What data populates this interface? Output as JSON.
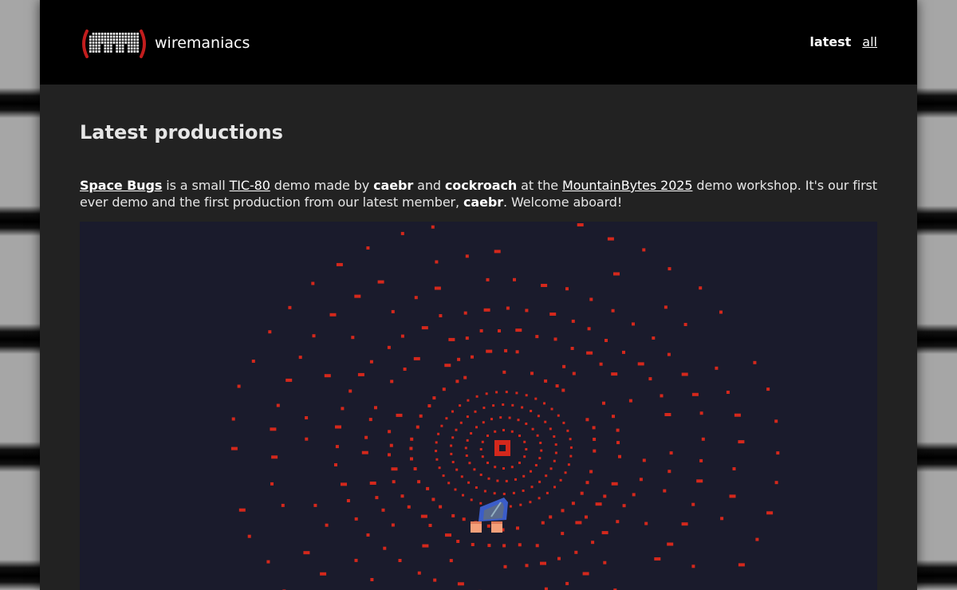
{
  "header": {
    "brand": "wiremaniacs",
    "logo_text": "(wm)",
    "nav": [
      {
        "label": "latest",
        "active": true
      },
      {
        "label": "all",
        "active": false
      }
    ]
  },
  "main": {
    "title": "Latest productions",
    "intro": {
      "prod_name": "Space Bugs",
      "t1": " is a small ",
      "platform": "TIC-80",
      "t2": " demo made by ",
      "author1": "caebr",
      "t3": " and ",
      "author2": "cockroach",
      "t4": " at the ",
      "event": "MountainBytes 2025",
      "t5": " demo workshop. It's our first ever demo and the first production from our latest member, ",
      "member": "caebr",
      "t6": ". Welcome aboard!"
    },
    "screenshot": {
      "background": "#1a1b2c",
      "dot_color": "#d4281c",
      "ship_colors": [
        "#3b5dc9",
        "#94b0c2",
        "#f4a07a"
      ]
    }
  },
  "colors": {
    "header_bg": "#000000",
    "page_bg": "#222222",
    "text": "#e6e6e6"
  }
}
